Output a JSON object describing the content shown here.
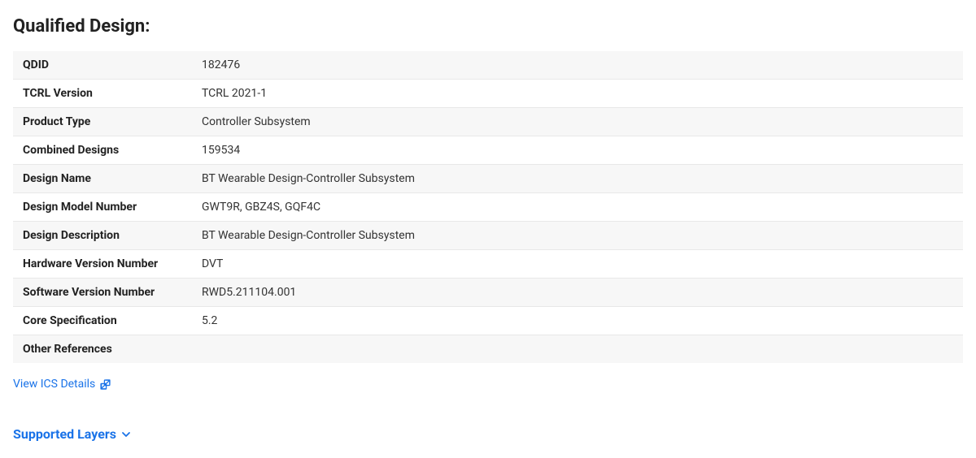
{
  "page": {
    "title": "Qualified Design:"
  },
  "table": {
    "rows": [
      {
        "label": "QDID",
        "value": "182476"
      },
      {
        "label": "TCRL Version",
        "value": "TCRL 2021-1"
      },
      {
        "label": "Product Type",
        "value": "Controller Subsystem"
      },
      {
        "label": "Combined Designs",
        "value": "159534"
      },
      {
        "label": "Design Name",
        "value": "BT Wearable Design-Controller Subsystem"
      },
      {
        "label": "Design Model Number",
        "value": "GWT9R, GBZ4S, GQF4C"
      },
      {
        "label": "Design Description",
        "value": "BT Wearable Design-Controller Subsystem"
      },
      {
        "label": "Hardware Version Number",
        "value": "DVT"
      },
      {
        "label": "Software Version Number",
        "value": "RWD5.211104.001"
      },
      {
        "label": "Core Specification",
        "value": "5.2"
      },
      {
        "label": "Other References",
        "value": ""
      }
    ]
  },
  "links": {
    "view_ics": "View ICS Details"
  },
  "supported_layers": {
    "heading": "Supported Layers"
  }
}
